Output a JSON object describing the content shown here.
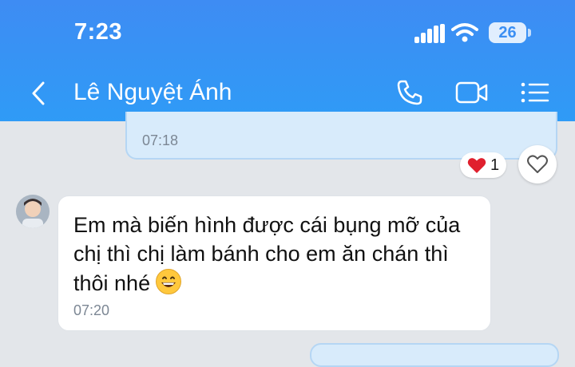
{
  "status_bar": {
    "time": "7:23",
    "battery_level": "26",
    "icons": [
      "signal-icon",
      "wifi-icon",
      "battery-icon"
    ]
  },
  "header": {
    "contact_name": "Lê Nguyệt Ánh",
    "icons": [
      "back-icon",
      "phone-icon",
      "video-call-icon",
      "menu-icon"
    ],
    "background": "#3e8cf3"
  },
  "messages": {
    "outgoing_time": "07:18",
    "reaction": {
      "emoji": "heart",
      "count": "1"
    },
    "incoming": {
      "text": "Em mà biến hình được cái bụng mỡ của chị thì chị làm bánh cho em ăn chán thì thôi nhé",
      "emoji": "grinning-face",
      "time": "07:20"
    }
  },
  "colors": {
    "chat_background": "#e3e6ea",
    "outgoing_bubble": "#d8ebfb",
    "incoming_bubble": "#ffffff",
    "reaction_heart": "#e0202e"
  }
}
